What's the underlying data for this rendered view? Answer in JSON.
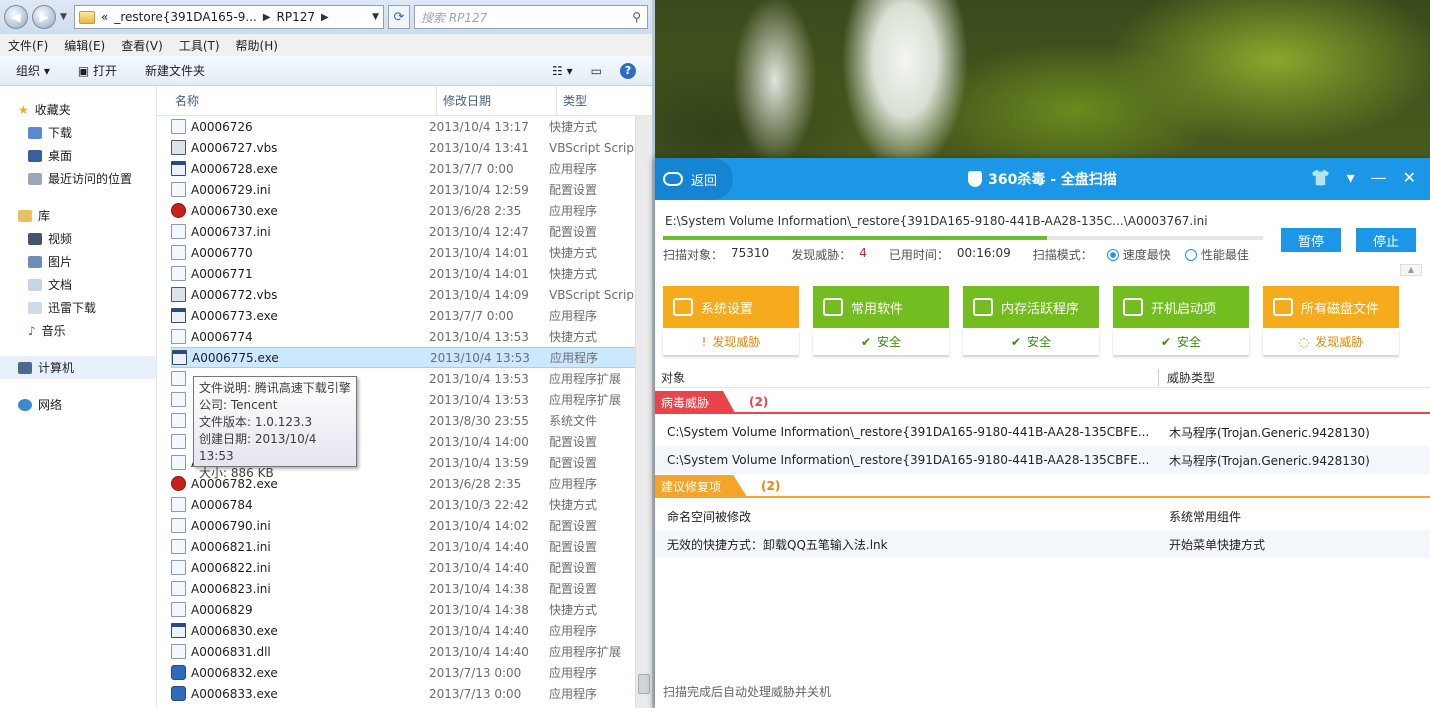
{
  "explorer": {
    "address": {
      "back": "«",
      "part1": "_restore{391DA165-9...",
      "part2": "RP127"
    },
    "search_placeholder": "搜索 RP127",
    "menu": [
      "文件(F)",
      "编辑(E)",
      "查看(V)",
      "工具(T)",
      "帮助(H)"
    ],
    "toolbar": {
      "organize": "组织",
      "open": "打开",
      "new_folder": "新建文件夹"
    },
    "sidebar": {
      "favorites": "收藏夹",
      "fav_items": [
        "下载",
        "桌面",
        "最近访问的位置"
      ],
      "libraries": "库",
      "lib_items": [
        "视频",
        "图片",
        "文档",
        "迅雷下载",
        "音乐"
      ],
      "computer": "计算机",
      "network": "网络"
    },
    "columns": {
      "name": "名称",
      "date": "修改日期",
      "type": "类型"
    },
    "files": [
      {
        "name": "A0006726",
        "date": "2013/10/4 13:17",
        "type": "快捷方式",
        "icon": "shortcut"
      },
      {
        "name": "A0006727.vbs",
        "date": "2013/10/4 13:41",
        "type": "VBScript Scrip",
        "icon": "vbs"
      },
      {
        "name": "A0006728.exe",
        "date": "2013/7/7 0:00",
        "type": "应用程序",
        "icon": "exe"
      },
      {
        "name": "A0006729.ini",
        "date": "2013/10/4 12:59",
        "type": "配置设置",
        "icon": "ini"
      },
      {
        "name": "A0006730.exe",
        "date": "2013/6/28 2:35",
        "type": "应用程序",
        "icon": "red"
      },
      {
        "name": "A0006737.ini",
        "date": "2013/10/4 12:47",
        "type": "配置设置",
        "icon": "ini"
      },
      {
        "name": "A0006770",
        "date": "2013/10/4 14:01",
        "type": "快捷方式",
        "icon": "shortcut"
      },
      {
        "name": "A0006771",
        "date": "2013/10/4 14:01",
        "type": "快捷方式",
        "icon": "shortcut"
      },
      {
        "name": "A0006772.vbs",
        "date": "2013/10/4 14:09",
        "type": "VBScript Scrip",
        "icon": "vbs"
      },
      {
        "name": "A0006773.exe",
        "date": "2013/7/7 0:00",
        "type": "应用程序",
        "icon": "exe"
      },
      {
        "name": "A0006774",
        "date": "2013/10/4 13:53",
        "type": "快捷方式",
        "icon": "shortcut"
      },
      {
        "name": "A0006775.exe",
        "date": "2013/10/4 13:53",
        "type": "应用程序",
        "icon": "exe",
        "selected": true
      },
      {
        "name": "",
        "date": "2013/10/4 13:53",
        "type": "应用程序扩展",
        "icon": "ini"
      },
      {
        "name": "",
        "date": "2013/10/4 13:53",
        "type": "应用程序扩展",
        "icon": "ini"
      },
      {
        "name": "",
        "date": "2013/8/30 23:55",
        "type": "系统文件",
        "icon": "ini"
      },
      {
        "name": "",
        "date": "2013/10/4 14:00",
        "type": "配置设置",
        "icon": "ini"
      },
      {
        "name": "A0006780.ini",
        "date": "2013/10/4 13:59",
        "type": "配置设置",
        "icon": "ini"
      },
      {
        "name": "A0006782.exe",
        "date": "2013/6/28 2:35",
        "type": "应用程序",
        "icon": "red"
      },
      {
        "name": "A0006784",
        "date": "2013/10/3 22:42",
        "type": "快捷方式",
        "icon": "shortcut"
      },
      {
        "name": "A0006790.ini",
        "date": "2013/10/4 14:02",
        "type": "配置设置",
        "icon": "ini"
      },
      {
        "name": "A0006821.ini",
        "date": "2013/10/4 14:40",
        "type": "配置设置",
        "icon": "ini"
      },
      {
        "name": "A0006822.ini",
        "date": "2013/10/4 14:40",
        "type": "配置设置",
        "icon": "ini"
      },
      {
        "name": "A0006823.ini",
        "date": "2013/10/4 14:38",
        "type": "配置设置",
        "icon": "ini"
      },
      {
        "name": "A0006829",
        "date": "2013/10/4 14:38",
        "type": "快捷方式",
        "icon": "shortcut"
      },
      {
        "name": "A0006830.exe",
        "date": "2013/10/4 14:40",
        "type": "应用程序",
        "icon": "exe"
      },
      {
        "name": "A0006831.dll",
        "date": "2013/10/4 14:40",
        "type": "应用程序扩展",
        "icon": "ini"
      },
      {
        "name": "A0006832.exe",
        "date": "2013/7/13 0:00",
        "type": "应用程序",
        "icon": "blue"
      },
      {
        "name": "A0006833.exe",
        "date": "2013/7/13 0:00",
        "type": "应用程序",
        "icon": "blue"
      }
    ],
    "tooltip": [
      "文件说明: 腾讯高速下载引擎",
      "公司: Tencent",
      "文件版本: 1.0.123.3",
      "创建日期: 2013/10/4 13:53",
      "大小: 886 KB"
    ]
  },
  "av": {
    "back": "返回",
    "title": "360杀毒 - 全盘扫描",
    "scan_path": "E:\\System Volume Information\\_restore{391DA165-9180-441B-AA28-135C...\\A0003767.ini",
    "progress": 0.64,
    "stats": {
      "scanned_label": "扫描对象：",
      "scanned": "75310",
      "threats_label": "发现威胁：",
      "threats": "4",
      "time_label": "已用时间：",
      "time": "00:16:09",
      "mode_label": "扫描模式：",
      "mode_fast": "速度最快",
      "mode_perf": "性能最佳"
    },
    "pause": "暂停",
    "stop": "停止",
    "cards": [
      {
        "title": "系统设置",
        "status": "发现威胁",
        "kind": "orange",
        "mark": "!"
      },
      {
        "title": "常用软件",
        "status": "安全",
        "kind": "green",
        "mark": "✔"
      },
      {
        "title": "内存活跃程序",
        "status": "安全",
        "kind": "green",
        "mark": "✔"
      },
      {
        "title": "开机启动项",
        "status": "安全",
        "kind": "green",
        "mark": "✔"
      },
      {
        "title": "所有磁盘文件",
        "status": "发现威胁",
        "kind": "orange",
        "mark": "◌"
      }
    ],
    "col_object": "对象",
    "col_threat_type": "威胁类型",
    "virus_section": {
      "label": "病毒威胁",
      "count": "(2)"
    },
    "virus_rows": [
      {
        "object": "C:\\System Volume Information\\_restore{391DA165-9180-441B-AA28-135CBFE...",
        "type": "木马程序(Trojan.Generic.9428130)"
      },
      {
        "object": "C:\\System Volume Information\\_restore{391DA165-9180-441B-AA28-135CBFE...",
        "type": "木马程序(Trojan.Generic.9428130)"
      }
    ],
    "fix_section": {
      "label": "建议修复项",
      "count": "(2)"
    },
    "fix_rows": [
      {
        "object": "命名空间被修改",
        "type": "系统常用组件"
      },
      {
        "object": "无效的快捷方式：卸载QQ五笔输入法.lnk",
        "type": "开始菜单快捷方式"
      }
    ],
    "footer": "扫描完成后自动处理威胁并关机"
  }
}
